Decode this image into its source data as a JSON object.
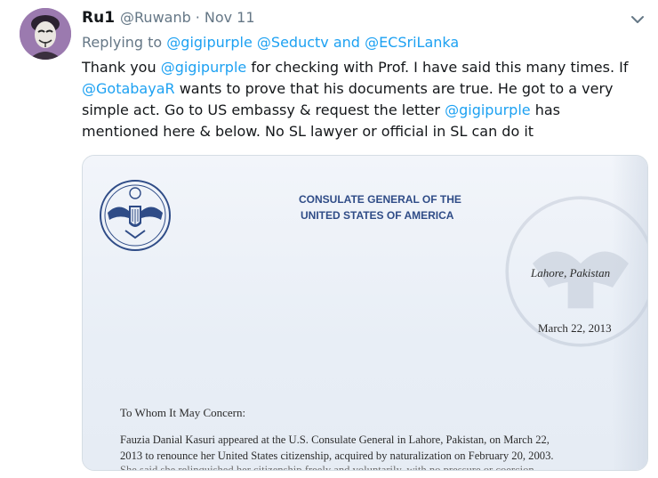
{
  "author": {
    "name": "Ru1",
    "handle": "@Ruwanb",
    "separator": "·",
    "date": "Nov 11",
    "avatar_icon": "masked-face-avatar"
  },
  "reply": {
    "prefix": "Replying to",
    "mention1": "@gigipurple",
    "mention2": "@Seductv",
    "conjunction": "and",
    "mention3": "@ECSriLanka"
  },
  "tweet": {
    "l1_a": "Thank you ",
    "l1_mention": "@gigipurple",
    "l1_b": " for checking with Prof. I have said this many times. If",
    "l2_mention": "@GotabayaR",
    "l2_b": " wants to prove that his documents are true. He got to a very",
    "l3": "simple act. Go to US embassy & request the letter ",
    "l3_mention": "@gigipurple",
    "l3_b": " has",
    "l4": "mentioned here & below. No SL lawyer or official in SL can do it"
  },
  "letter": {
    "heading1": "CONSULATE GENERAL OF THE",
    "heading2": "UNITED STATES OF AMERICA",
    "city": "Lahore, Pakistan",
    "date": "March 22, 2013",
    "salutation": "To Whom It May Concern:",
    "body_line1": "Fauzia Danial Kasuri appeared at the U.S. Consulate General in Lahore, Pakistan, on March 22,",
    "body_line2": "2013 to renounce her United States citizenship, acquired by naturalization on February 20, 2003.",
    "body_line3": "She said she relinquished her citizenship freely and voluntarily, with no pressure or coercion..."
  },
  "colors": {
    "link": "#1da1f2",
    "secondary": "#657786",
    "primary_text": "#14171a",
    "letterhead": "#2f4c87"
  },
  "icons": {
    "chevron": "chevron-down-icon",
    "seal": "great-seal-icon"
  }
}
